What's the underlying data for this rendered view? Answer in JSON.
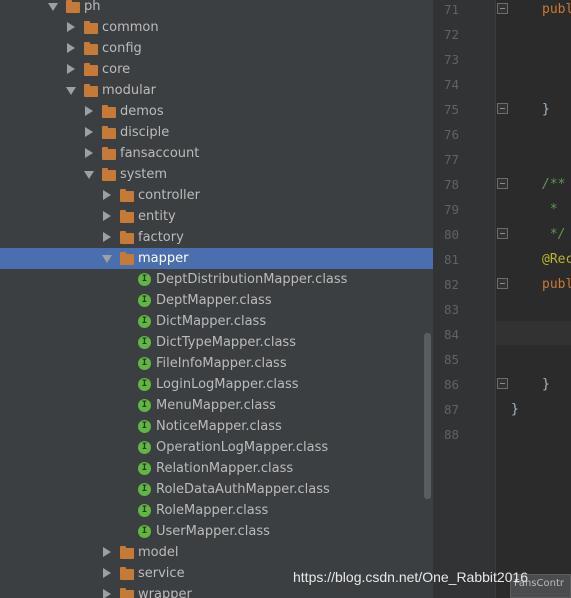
{
  "tree": {
    "rows": [
      {
        "label": "ph",
        "kind": "folder",
        "state": "expanded",
        "depth": 0
      },
      {
        "label": "common",
        "kind": "folder",
        "state": "collapsed",
        "depth": 1
      },
      {
        "label": "config",
        "kind": "folder",
        "state": "collapsed",
        "depth": 1
      },
      {
        "label": "core",
        "kind": "folder",
        "state": "collapsed",
        "depth": 1
      },
      {
        "label": "modular",
        "kind": "folder",
        "state": "expanded",
        "depth": 1
      },
      {
        "label": "demos",
        "kind": "folder",
        "state": "collapsed",
        "depth": 2
      },
      {
        "label": "disciple",
        "kind": "folder",
        "state": "collapsed",
        "depth": 2
      },
      {
        "label": "fansaccount",
        "kind": "folder",
        "state": "collapsed",
        "depth": 2
      },
      {
        "label": "system",
        "kind": "folder",
        "state": "expanded",
        "depth": 2
      },
      {
        "label": "controller",
        "kind": "folder",
        "state": "collapsed",
        "depth": 3
      },
      {
        "label": "entity",
        "kind": "folder",
        "state": "collapsed",
        "depth": 3
      },
      {
        "label": "factory",
        "kind": "folder",
        "state": "collapsed",
        "depth": 3
      },
      {
        "label": "mapper",
        "kind": "folder",
        "state": "expanded",
        "depth": 3,
        "selected": true
      },
      {
        "label": "DeptDistributionMapper.class",
        "kind": "interface",
        "depth": 4
      },
      {
        "label": "DeptMapper.class",
        "kind": "interface",
        "depth": 4
      },
      {
        "label": "DictMapper.class",
        "kind": "interface",
        "depth": 4
      },
      {
        "label": "DictTypeMapper.class",
        "kind": "interface",
        "depth": 4
      },
      {
        "label": "FileInfoMapper.class",
        "kind": "interface",
        "depth": 4
      },
      {
        "label": "LoginLogMapper.class",
        "kind": "interface",
        "depth": 4
      },
      {
        "label": "MenuMapper.class",
        "kind": "interface",
        "depth": 4
      },
      {
        "label": "NoticeMapper.class",
        "kind": "interface",
        "depth": 4
      },
      {
        "label": "OperationLogMapper.class",
        "kind": "interface",
        "depth": 4
      },
      {
        "label": "RelationMapper.class",
        "kind": "interface",
        "depth": 4
      },
      {
        "label": "RoleDataAuthMapper.class",
        "kind": "interface",
        "depth": 4
      },
      {
        "label": "RoleMapper.class",
        "kind": "interface",
        "depth": 4
      },
      {
        "label": "UserMapper.class",
        "kind": "interface",
        "depth": 4
      },
      {
        "label": "model",
        "kind": "folder",
        "state": "collapsed",
        "depth": 3
      },
      {
        "label": "service",
        "kind": "folder",
        "state": "collapsed",
        "depth": 3
      },
      {
        "label": "wrapper",
        "kind": "folder",
        "state": "collapsed",
        "depth": 3
      }
    ],
    "interface_glyph": "I"
  },
  "editor": {
    "line_numbers": [
      "71",
      "72",
      "73",
      "74",
      "75",
      "76",
      "77",
      "78",
      "79",
      "80",
      "81",
      "82",
      "83",
      "84",
      "85",
      "86",
      "87",
      "88"
    ],
    "code": {
      "l71": "publ",
      "l75": "}",
      "l78": "/**",
      "l79": " *",
      "l80": " */",
      "l81": "@Rec",
      "l82": "publ",
      "l86": "}",
      "l87": "}"
    },
    "tooltip": "FansContr"
  },
  "watermark": "https://blog.csdn.net/One_Rabbit2016",
  "colors": {
    "panel": "#3c3f41",
    "selection": "#4b6eaf",
    "folder": "#c57a38",
    "interface_icon": "#62b543",
    "editor_bg": "#2b2b2b",
    "keyword": "#cc7832",
    "comment": "#629755",
    "annotation": "#bbb529"
  },
  "icons": {
    "folder": "folder-icon",
    "interface": "interface-icon",
    "expanded": "triangle-down-icon",
    "collapsed": "triangle-right-icon",
    "fold": "fold-marker-icon"
  }
}
